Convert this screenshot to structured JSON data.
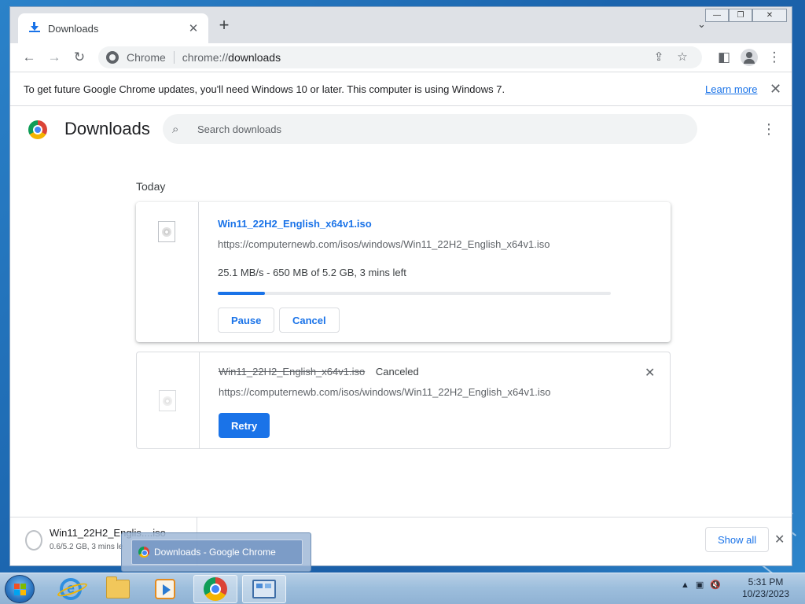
{
  "browser": {
    "tab": {
      "title": "Downloads",
      "close": "✕"
    },
    "new_tab": "+",
    "tab_search": "⌄",
    "window_controls": {
      "minimize": "—",
      "maximize": "❐",
      "close": "✕"
    },
    "toolbar": {
      "back": "←",
      "forward": "→",
      "reload": "↻",
      "site_name": "Chrome",
      "url_scheme": "chrome://",
      "url_path": "downloads",
      "share": "⇪",
      "bookmark": "☆",
      "side_panel": "◧",
      "menu": "⋮"
    },
    "infobar": {
      "text": "To get future Google Chrome updates, you'll need Windows 10 or later. This computer is using Windows 7.",
      "link": "Learn more",
      "close": "✕"
    }
  },
  "downloads_page": {
    "title": "Downloads",
    "search_placeholder": "Search downloads",
    "search_icon": "⌕",
    "menu": "⋮",
    "date_group": "Today",
    "items": [
      {
        "filename": "Win11_22H2_English_x64v1.iso",
        "url": "https://computernewb.com/isos/windows/Win11_22H2_English_x64v1.iso",
        "status": "25.1 MB/s - 650 MB of 5.2 GB, 3 mins left",
        "progress": 0.12,
        "pause_label": "Pause",
        "cancel_label": "Cancel"
      },
      {
        "filename": "Win11_22H2_English_x64v1.iso",
        "state_label": "Canceled",
        "url": "https://computernewb.com/isos/windows/Win11_22H2_English_x64v1.iso",
        "retry_label": "Retry",
        "remove": "✕"
      }
    ]
  },
  "download_shelf": {
    "item_name": "Win11_22H2_Englis....iso",
    "item_status": "0.6/5.2 GB, 3 mins le",
    "show_all_label": "Show all",
    "close": "✕"
  },
  "taskbar": {
    "thumbnail_title": "Downloads - Google Chrome",
    "clock_time": "5:31 PM",
    "clock_date": "10/23/2023",
    "tray_icons": [
      "▲",
      "network-icon",
      "volume-muted-icon"
    ]
  }
}
